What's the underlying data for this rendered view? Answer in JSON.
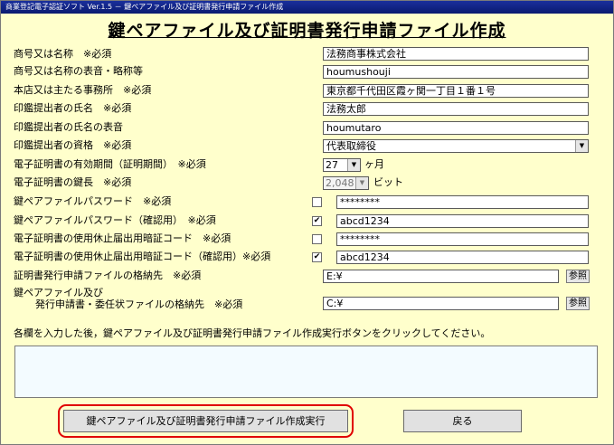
{
  "window": {
    "title": "商業登記電子認証ソフト Ver.1.5 － 鍵ペアファイル及び証明書発行申請ファイル作成"
  },
  "heading": "鍵ペアファイル及び証明書発行申請ファイル作成",
  "form": {
    "trade_name": {
      "label": "商号又は名称　※必須",
      "value": "法務商事株式会社"
    },
    "trade_name_reading": {
      "label": "商号又は名称の表音・略称等",
      "value": "houmushouji"
    },
    "office": {
      "label": "本店又は主たる事務所　※必須",
      "value": "東京都千代田区霞ヶ関一丁目１番１号"
    },
    "seal_submitter_name": {
      "label": "印鑑提出者の氏名　※必須",
      "value": "法務太郎"
    },
    "seal_submitter_reading": {
      "label": "印鑑提出者の氏名の表音",
      "value": "houmutaro"
    },
    "seal_submitter_qualification": {
      "label": "印鑑提出者の資格　※必須",
      "value": "代表取締役"
    },
    "validity": {
      "label": "電子証明書の有効期間（証明期間）　※必須",
      "value": "27",
      "unit": "ヶ月"
    },
    "key_length": {
      "label": "電子証明書の鍵長　※必須",
      "value": "2,048",
      "unit": "ビット"
    },
    "key_password": {
      "label": "鍵ペアファイルパスワード　※必須",
      "checked": false,
      "value": "********"
    },
    "key_password_confirm": {
      "label": "鍵ペアファイルパスワード（確認用）　※必須",
      "checked": true,
      "value": "abcd1234"
    },
    "suspension_code": {
      "label": "電子証明書の使用休止届出用暗証コード　※必須",
      "checked": false,
      "value": "********"
    },
    "suspension_code_confirm": {
      "label": "電子証明書の使用休止届出用暗証コード（確認用）※必須",
      "checked": true,
      "value": "abcd1234"
    },
    "request_file_dir": {
      "label": "証明書発行申請ファイルの格納先　※必須",
      "value": "E:¥",
      "browse": "参照"
    },
    "key_file_dir": {
      "label_line1": "鍵ペアファイル及び",
      "label_line2": "発行申請書・委任状ファイルの格納先　※必須",
      "value": "C:¥",
      "browse": "参照"
    }
  },
  "instruction": "各欄を入力した後，鍵ペアファイル及び証明書発行申請ファイル作成実行ボタンをクリックしてください。",
  "buttons": {
    "execute": "鍵ペアファイル及び証明書発行申請ファイル作成実行",
    "back": "戻る"
  },
  "icons": {
    "dropdown": "▼",
    "check": "✔"
  },
  "colors": {
    "background": "#ffffcc",
    "title_bar": "#0a1a70",
    "highlight_ring": "#e00000"
  }
}
